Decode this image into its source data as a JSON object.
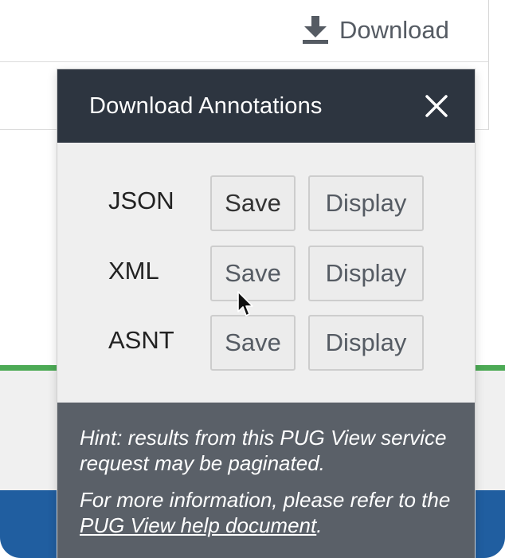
{
  "toolbar": {
    "download_label": "Download",
    "download_icon": "download-icon"
  },
  "dialog": {
    "title": "Download Annotations",
    "close_icon": "close-icon",
    "formats": [
      {
        "label": "JSON",
        "save_label": "Save",
        "display_label": "Display"
      },
      {
        "label": "XML",
        "save_label": "Save",
        "display_label": "Display"
      },
      {
        "label": "ASNT",
        "save_label": "Save",
        "display_label": "Display"
      }
    ],
    "hint": {
      "line1": "Hint: results from this PUG View service request may be paginated.",
      "line2_prefix": "For more information, please refer to the ",
      "link_text": "PUG View help document",
      "line2_suffix": "."
    }
  },
  "colors": {
    "header_bg": "#2d3540",
    "hint_bg": "#5a6068",
    "green_rule": "#4caa55",
    "footer_blue": "#205ea0"
  }
}
